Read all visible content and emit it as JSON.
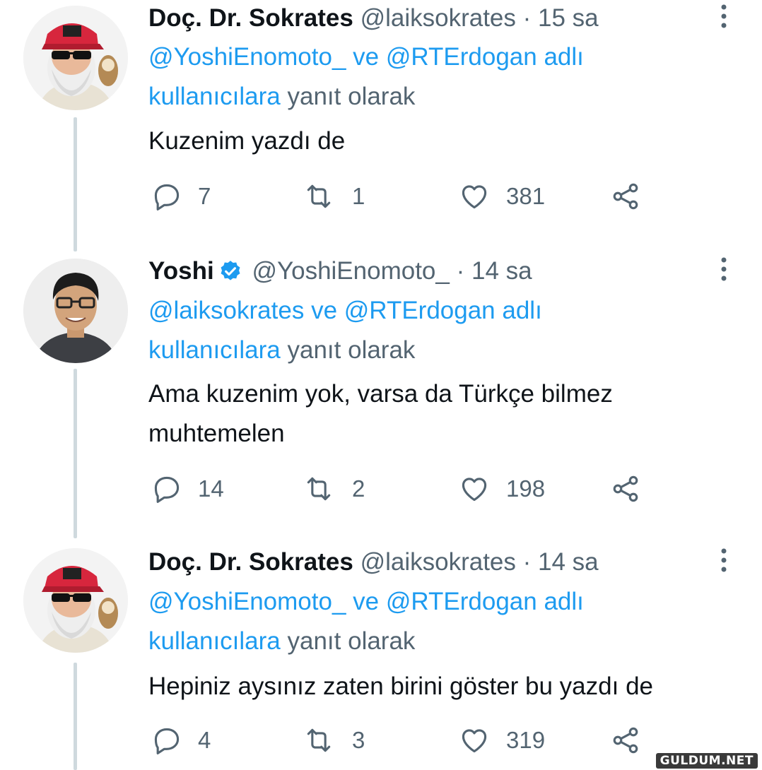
{
  "tweets": [
    {
      "name": "Doç. Dr. Sokrates",
      "handle": "@laiksokrates",
      "sep": "·",
      "time": "15 sa",
      "verified": false,
      "reply_mention_1": "@YoshiEnomoto_",
      "reply_and": "ve",
      "reply_mention_2": "@RTErdogan adlı",
      "reply_mention_3": "kullanıcılara",
      "reply_suffix": "yanıt olarak",
      "text": "Kuzenim yazdı de",
      "replies": "7",
      "retweets": "1",
      "likes": "381"
    },
    {
      "name": "Yoshi",
      "handle": "@YoshiEnomoto_",
      "sep": "·",
      "time": "14 sa",
      "verified": true,
      "reply_mention_1": "@laiksokrates",
      "reply_and": "ve",
      "reply_mention_2": "@RTErdogan adlı",
      "reply_mention_3": "kullanıcılara",
      "reply_suffix": "yanıt olarak",
      "text_line_1": "Ama kuzenim yok, varsa da Türkçe bilmez",
      "text_line_2": "muhtemelen",
      "replies": "14",
      "retweets": "2",
      "likes": "198"
    },
    {
      "name": "Doç. Dr. Sokrates",
      "handle": "@laiksokrates",
      "sep": "·",
      "time": "14 sa",
      "verified": false,
      "reply_mention_1": "@YoshiEnomoto_",
      "reply_and": "ve",
      "reply_mention_2": "@RTErdogan adlı",
      "reply_mention_3": "kullanıcılara",
      "reply_suffix": "yanıt olarak",
      "text": "Hepiniz aysınız zaten birini göster bu yazdı de",
      "replies": "4",
      "retweets": "3",
      "likes": "319"
    }
  ],
  "colors": {
    "accent": "#1d9bf0",
    "secondary": "#536471",
    "text": "#0f1419",
    "thread_line": "#cfd9de"
  },
  "icons": [
    "reply-icon",
    "retweet-icon",
    "like-icon",
    "share-icon",
    "more-icon",
    "verified-badge-icon"
  ],
  "watermark": "GULDUM.NET"
}
